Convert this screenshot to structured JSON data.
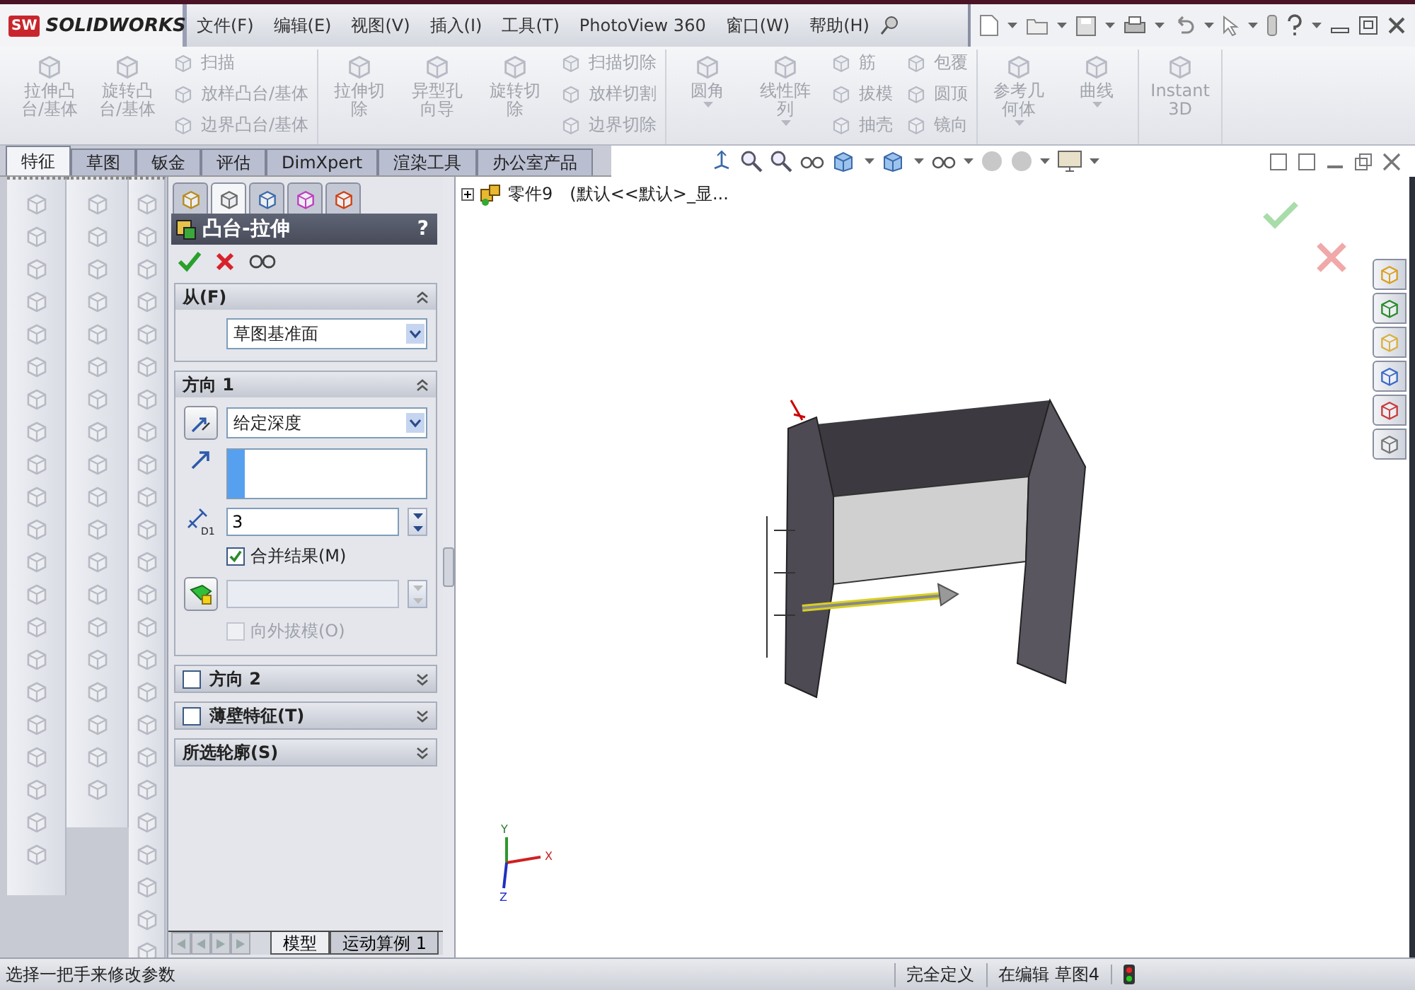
{
  "title_bar": {
    "logo_badge": "SW",
    "logo_text": "SOLIDWORKS",
    "menus": [
      "文件(F)",
      "编辑(E)",
      "视图(V)",
      "插入(I)",
      "工具(T)",
      "PhotoView 360",
      "窗口(W)",
      "帮助(H)"
    ]
  },
  "ribbon": {
    "disabled": true,
    "groups": [
      {
        "items": [
          {
            "kind": "large",
            "label": "拉伸凸台/基体",
            "dropdown": false
          },
          {
            "kind": "large",
            "label": "旋转凸台/基体",
            "dropdown": false
          },
          {
            "kind": "stack",
            "labels": [
              "扫描",
              "放样凸台/基体",
              "边界凸台/基体"
            ]
          }
        ]
      },
      {
        "items": [
          {
            "kind": "large",
            "label": "拉伸切除",
            "dropdown": false
          },
          {
            "kind": "large",
            "label": "异型孔向导",
            "dropdown": false
          },
          {
            "kind": "large",
            "label": "旋转切除",
            "dropdown": false
          },
          {
            "kind": "stack",
            "labels": [
              "扫描切除",
              "放样切割",
              "边界切除"
            ]
          }
        ]
      },
      {
        "items": [
          {
            "kind": "large",
            "label": "圆角",
            "dropdown": true
          },
          {
            "kind": "large",
            "label": "线性阵列",
            "dropdown": true
          },
          {
            "kind": "stack",
            "labels": [
              "筋",
              "拔模",
              "抽壳"
            ]
          },
          {
            "kind": "stack",
            "labels": [
              "包覆",
              "圆顶",
              "镜向"
            ]
          }
        ]
      },
      {
        "items": [
          {
            "kind": "large",
            "label": "参考几何体",
            "dropdown": true
          },
          {
            "kind": "large",
            "label": "曲线",
            "dropdown": true
          }
        ]
      },
      {
        "items": [
          {
            "kind": "large",
            "label": "Instant3D",
            "dropdown": false
          }
        ]
      }
    ]
  },
  "command_tabs": [
    {
      "label": "特征",
      "selected": true
    },
    {
      "label": "草图",
      "selected": false
    },
    {
      "label": "钣金",
      "selected": false
    },
    {
      "label": "评估",
      "selected": false
    },
    {
      "label": "DimXpert",
      "selected": false
    },
    {
      "label": "渲染工具",
      "selected": false
    },
    {
      "label": "办公室产品",
      "selected": false
    }
  ],
  "property_manager": {
    "tabs": [
      {
        "selected": false
      },
      {
        "selected": true
      },
      {
        "selected": false
      },
      {
        "selected": false
      },
      {
        "selected": false
      }
    ],
    "title": "凸台-拉伸",
    "help": "?",
    "sections": [
      {
        "kind": "from",
        "title": "从(F)",
        "expanded": true,
        "select": "草图基准面"
      },
      {
        "kind": "direction",
        "title": "方向 1",
        "expanded": true,
        "end_condition": "给定深度",
        "depth": "3",
        "dimension_label": "D1",
        "draft_field": {
          "disabled": true
        },
        "checkboxes": [
          {
            "label": "合并结果(M)",
            "checked": true,
            "disabled": false
          },
          {
            "label": "向外拔模(O)",
            "checked": false,
            "disabled": true
          }
        ]
      },
      {
        "kind": "optional",
        "title": "方向 2",
        "checked": false,
        "expanded": false
      },
      {
        "kind": "optional",
        "title": "薄壁特征(T)",
        "checked": false,
        "expanded": false
      },
      {
        "kind": "plain",
        "title": "所选轮廓(S)",
        "expanded": false
      }
    ],
    "bottom_tabs": [
      {
        "label": "模型",
        "selected": true
      },
      {
        "label": "运动算例 1",
        "selected": false
      }
    ]
  },
  "viewport": {
    "tree_item": {
      "name": "零件9",
      "config": "(默认<<默认>_显..."
    },
    "axes": [
      "X",
      "Y",
      "Z"
    ]
  },
  "status_bar": {
    "message": "选择一把手来修改参数",
    "fields": [
      "完全定义",
      "在编辑 草图4"
    ]
  }
}
